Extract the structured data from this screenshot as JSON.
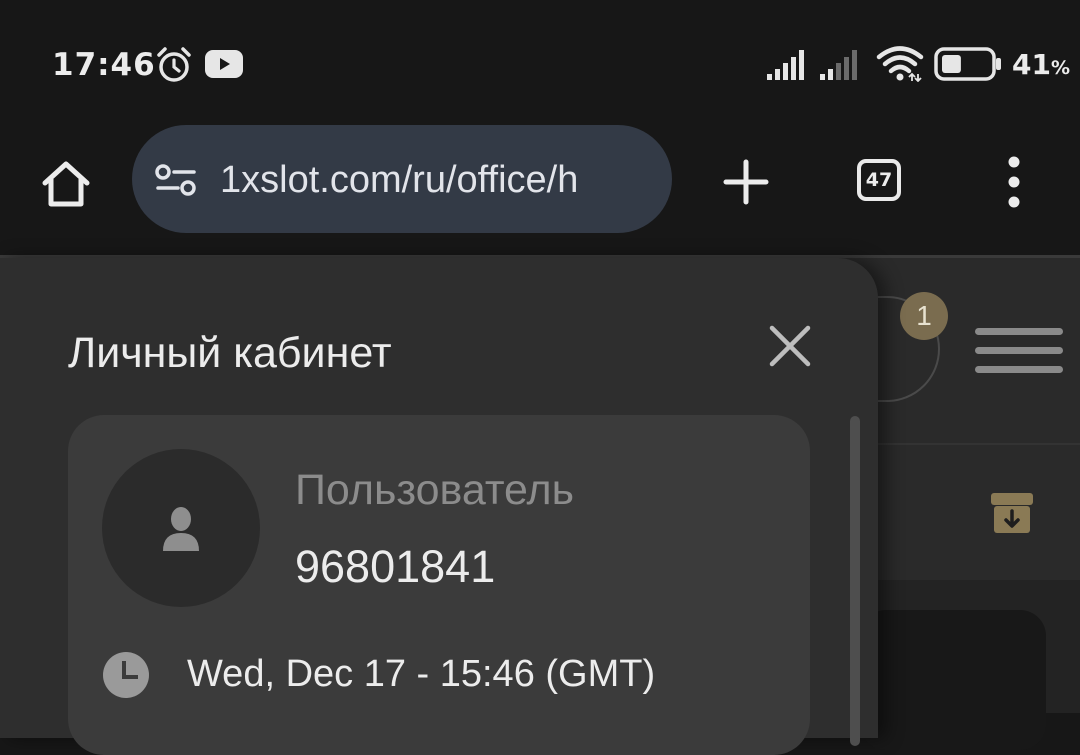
{
  "status_bar": {
    "time": "17:46",
    "battery_percent": "41",
    "battery_unit": "%",
    "battery_level": 0.41,
    "icons": [
      "alarm-icon",
      "youtube-icon",
      "signal-icon",
      "signal-icon",
      "wifi-icon",
      "battery-icon"
    ]
  },
  "browser": {
    "url": "1xslot.com/ru/office/h",
    "tab_count": "47",
    "icons": [
      "home-icon",
      "site-settings-icon",
      "plus-icon",
      "more-vert-icon"
    ],
    "url_bar_color": "#333a46"
  },
  "page_background": {
    "notification_count": "1",
    "accent_color": "#7a6c4f",
    "icons": [
      "hamburger-menu-icon",
      "deposit-box-icon"
    ]
  },
  "panel": {
    "title": "Личный кабинет",
    "user": {
      "label": "Пользователь",
      "id": "96801841"
    },
    "session_time": "Wed, Dec 17 - 15:46 (GMT)",
    "icons": [
      "close-icon",
      "user-icon",
      "clock-icon"
    ]
  }
}
